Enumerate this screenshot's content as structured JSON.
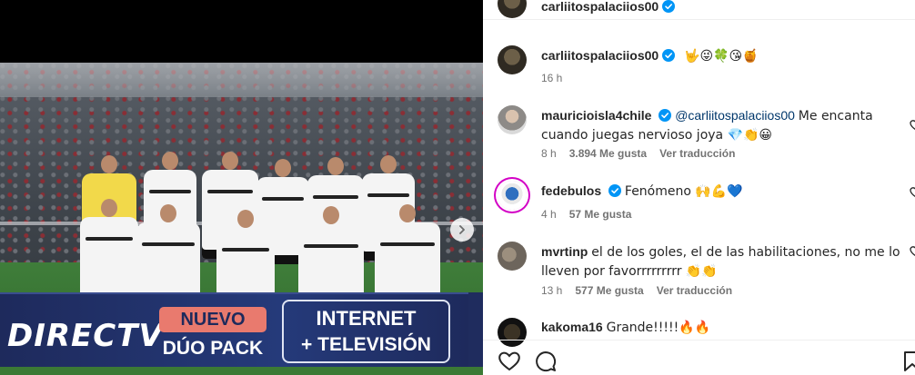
{
  "media": {
    "ad_brand": "DIRECTV",
    "ad_nuevo": "NUEVO",
    "ad_duo": "DÚO PACK",
    "ad_internet": "INTERNET",
    "ad_tv": "+ TELEVISIÓN"
  },
  "header": {
    "username": "carliitospalaciios00"
  },
  "caption": {
    "username": "carliitospalaciios00",
    "text": "🤟😜🍀😘🍯",
    "time": "16 h"
  },
  "comments": [
    {
      "username": "mauricioisla4chile",
      "mention": "@carliitospalaciios00",
      "text": "Me encanta cuando juegas nervioso joya 💎👏😀",
      "time": "8 h",
      "likes": "3.894 Me gusta",
      "reply": "Ver traducción"
    },
    {
      "username": "fedebulos",
      "text": "Fenómeno 🙌💪💙",
      "time": "4 h",
      "likes": "57 Me gusta"
    },
    {
      "username": "mvrtinp",
      "text": "el de los goles, el de las habilitaciones, no me lo lleven por favorrrrrrrrr 👏👏",
      "time": "13 h",
      "likes": "577 Me gusta",
      "reply": "Ver traducción"
    },
    {
      "username": "kakoma16",
      "text": "Grande!!!!!🔥🔥"
    }
  ],
  "icons": {
    "verified": "verified-badge-icon",
    "like": "heart-icon",
    "comment": "comment-icon",
    "save": "bookmark-icon",
    "next": "chevron-right-icon"
  },
  "colors": {
    "verified_blue": "#0095f6",
    "meta_grey": "#737373",
    "mention_blue": "#00376b",
    "story_ring": "#d300c5"
  }
}
